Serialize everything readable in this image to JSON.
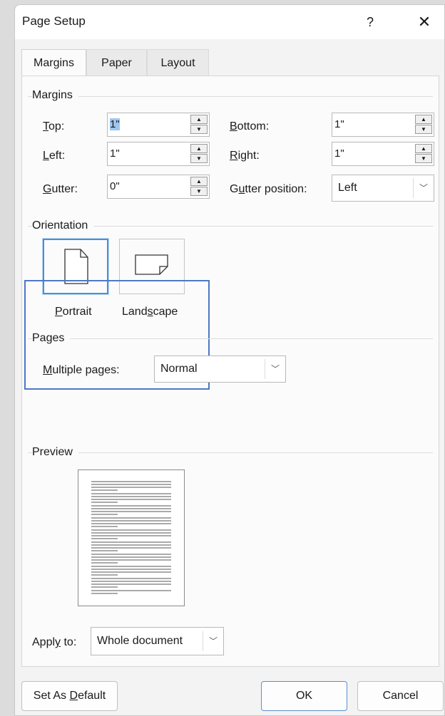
{
  "window": {
    "title": "Page Setup",
    "help": "?",
    "close": "✕"
  },
  "tabs": {
    "margins": "Margins",
    "paper": "Paper",
    "layout": "Layout"
  },
  "margins_group": {
    "heading": "Margins",
    "top": {
      "label_u": "T",
      "label_rest": "op:",
      "value": "1\""
    },
    "bottom": {
      "label_u": "B",
      "label_rest": "ottom:",
      "value": "1\""
    },
    "left": {
      "label_u": "L",
      "label_rest": "eft:",
      "value": "1\""
    },
    "right": {
      "label_u": "R",
      "label_rest": "ight:",
      "value": "1\""
    },
    "gutter": {
      "label_u": "G",
      "label_rest": "utter:",
      "value": "0\""
    },
    "gutter_position": {
      "label_pre": "G",
      "label_u": "u",
      "label_rest": "tter position:",
      "value": "Left"
    }
  },
  "orientation": {
    "heading": "Orientation",
    "portrait": {
      "label_u": "P",
      "label_rest": "ortrait",
      "selected": true
    },
    "landscape": {
      "label_pre": "Land",
      "label_u": "s",
      "label_rest": "cape"
    }
  },
  "pages": {
    "heading": "Pages",
    "multiple_label_u": "M",
    "multiple_label_rest": "ultiple pages:",
    "multiple_value": "Normal"
  },
  "preview": {
    "heading": "Preview"
  },
  "apply_to": {
    "label_pre": "Appl",
    "label_u": "y",
    "label_rest": " to:",
    "value": "Whole document"
  },
  "buttons": {
    "default_pre": "Set As ",
    "default_u": "D",
    "default_rest": "efault",
    "ok": "OK",
    "cancel": "Cancel"
  },
  "colors": {
    "focus": "#4e78c4",
    "selection": "#9ec7f0",
    "accent": "#4a8fd6"
  }
}
